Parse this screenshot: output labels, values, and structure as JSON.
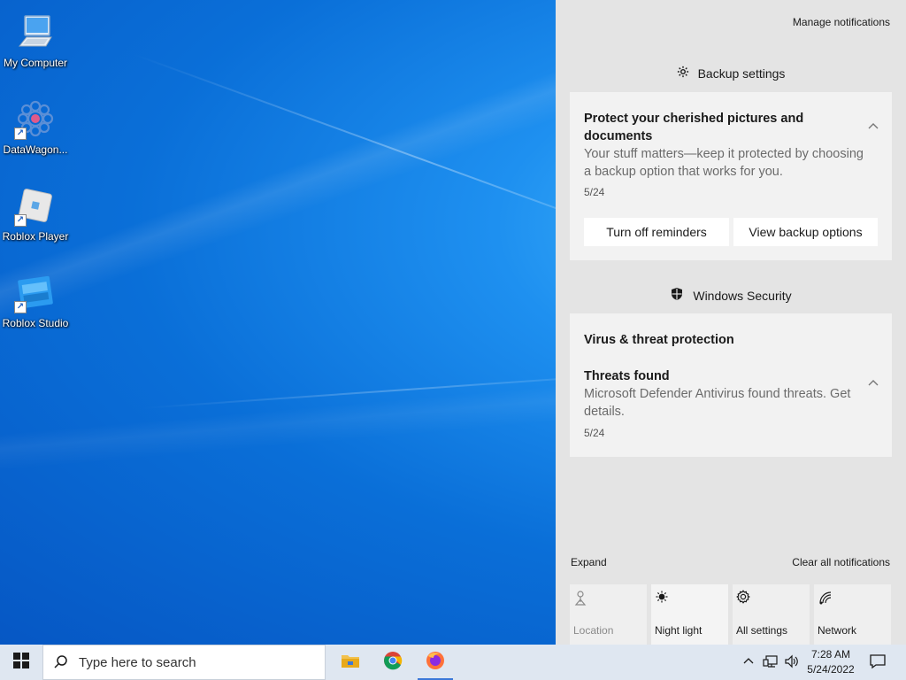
{
  "desktop": {
    "icons": [
      {
        "label": "My Computer",
        "icon": "computer-icon"
      },
      {
        "label": "DataWagon...",
        "icon": "datawagon-icon"
      },
      {
        "label": "Roblox Player",
        "icon": "roblox-player-icon"
      },
      {
        "label": "Roblox Studio",
        "icon": "roblox-studio-icon"
      }
    ]
  },
  "action_center": {
    "manage_label": "Manage notifications",
    "groups": [
      {
        "header": "Backup settings",
        "icon": "gear-icon",
        "title": "Protect your cherished pictures and documents",
        "body": "Your stuff matters—keep it protected by choosing a backup option that works for you.",
        "date": "5/24",
        "buttons": [
          "Turn off reminders",
          "View backup options"
        ]
      },
      {
        "header": "Windows Security",
        "icon": "shield-icon",
        "subheader": "Virus & threat protection",
        "title": "Threats found",
        "body": "Microsoft Defender Antivirus found threats. Get details.",
        "date": "5/24"
      }
    ],
    "expand_label": "Expand",
    "clear_label": "Clear all notifications",
    "quick_actions": [
      {
        "label": "Location",
        "icon": "location-icon",
        "state": "disabled"
      },
      {
        "label": "Night light",
        "icon": "night-light-icon",
        "state": "active"
      },
      {
        "label": "All settings",
        "icon": "settings-icon",
        "state": "normal"
      },
      {
        "label": "Network",
        "icon": "network-icon",
        "state": "normal"
      }
    ]
  },
  "taskbar": {
    "search_placeholder": "Type here to search",
    "apps": [
      "file-explorer-icon",
      "chrome-icon",
      "firefox-icon"
    ],
    "time": "7:28 AM",
    "date": "5/24/2022"
  },
  "colors": {
    "accent": "#3b78d8",
    "desktop_blue": "#0a6fd8",
    "panel": "#e4e4e4",
    "card": "#f2f2f2"
  }
}
